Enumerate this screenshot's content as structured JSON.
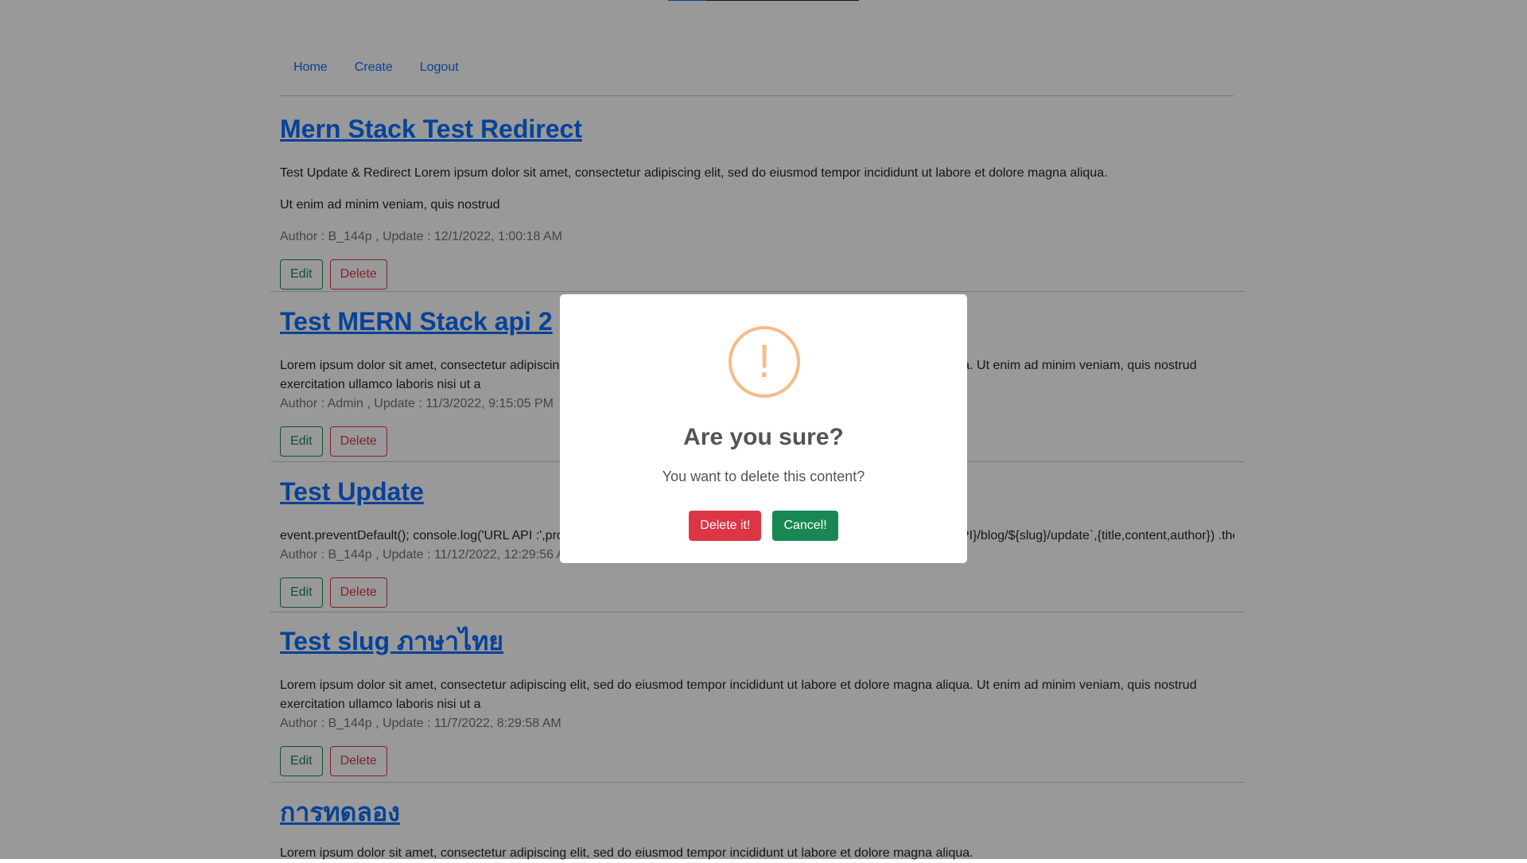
{
  "nav": {
    "home": "Home",
    "create": "Create",
    "logout": "Logout"
  },
  "posts": [
    {
      "title": "Mern Stack  Test Redirect",
      "paragraphs": [
        "Test Update & Redirect Lorem ipsum dolor sit amet, consectetur adipiscing elit, sed do eiusmod tempor incididunt ut labore et dolore magna aliqua.",
        "Ut enim ad minim veniam, quis nostrud"
      ],
      "meta": "Author : B_144p , Update : 12/1/2022, 1:00:18 AM"
    },
    {
      "title": "Test MERN Stack  api 2",
      "paragraphs": [
        "Lorem ipsum dolor sit amet, consectetur adipiscing elit, sed do eiusmod tempor incididunt ut labore et dolore magna aliqua. Ut enim ad minim veniam, quis nostrud exercitation ullamco laboris nisi ut a"
      ],
      "meta": "Author : Admin , Update : 11/3/2022, 9:15:05 PM"
    },
    {
      "title": "Test Update",
      "paragraphs": [
        "event.preventDefault(); console.log('URL API :',process.env.REACT_APP_API) axios.put(`${process.env.REACT_APP_API}/blog/${slug}/update`,{title,content,author}) .then(res=>{ //"
      ],
      "meta": "Author : B_144p , Update : 11/12/2022, 12:29:56 AM"
    },
    {
      "title": "Test slug ภาษาไทย",
      "paragraphs": [
        "Lorem ipsum dolor sit amet, consectetur adipiscing elit, sed do eiusmod tempor incididunt ut labore et dolore magna aliqua. Ut enim ad minim veniam, quis nostrud exercitation ullamco laboris nisi ut a"
      ],
      "meta": "Author : B_144p , Update : 11/7/2022, 8:29:58 AM"
    },
    {
      "title": "การทดลอง",
      "paragraphs": [
        "Lorem ipsum dolor sit amet, consectetur adipiscing elit, sed do eiusmod tempor incididunt ut labore et dolore magna aliqua."
      ],
      "meta": ""
    }
  ],
  "buttons": {
    "edit": "Edit",
    "delete": "Delete"
  },
  "modal": {
    "icon": "!",
    "title": "Are you sure?",
    "message": "You want to delete this content?",
    "confirm": "Delete it!",
    "cancel": "Cancel!"
  },
  "colors": {
    "link": "#0d6efd",
    "edit": "#198754",
    "delete": "#dc3545",
    "warning_icon": "#f8bb86"
  }
}
